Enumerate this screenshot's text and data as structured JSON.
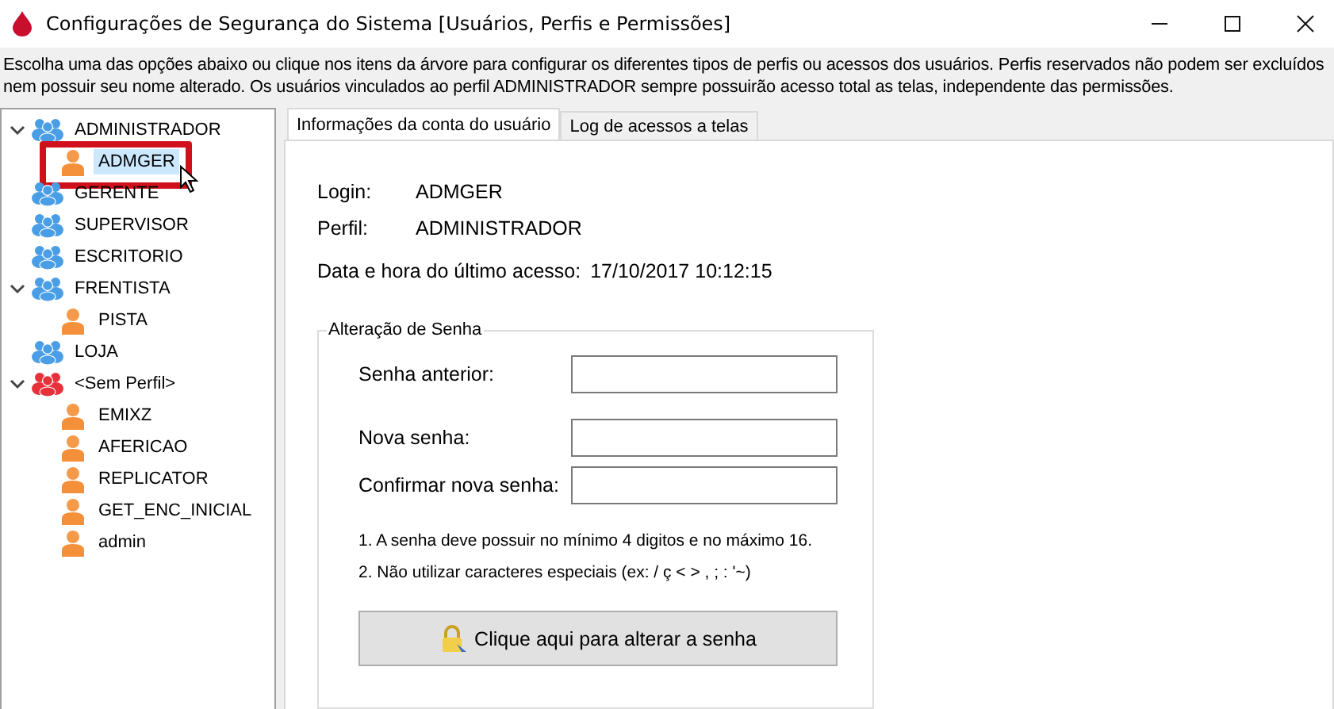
{
  "window": {
    "title": "Configurações de Segurança do Sistema [Usuários, Perfis e Permissões]"
  },
  "description": "Escolha uma das opções abaixo ou clique nos itens da árvore para configurar os diferentes tipos de perfis ou acessos dos usuários. Perfis reservados não podem ser excluídos nem possuir seu nome alterado. Os usuários vinculados ao perfil ADMINISTRADOR sempre possuirão acesso total as telas, independente das permissões.",
  "tree": [
    {
      "label": "ADMINISTRADOR",
      "kind": "group",
      "color": "#4a9ee6",
      "selected": false,
      "expanded": true,
      "children": [
        {
          "label": "ADMGER",
          "kind": "user",
          "selected": true
        }
      ]
    },
    {
      "label": "GERENTE",
      "kind": "group",
      "color": "#4a9ee6",
      "selected": false
    },
    {
      "label": "SUPERVISOR",
      "kind": "group",
      "color": "#4a9ee6",
      "selected": false
    },
    {
      "label": "ESCRITORIO",
      "kind": "group",
      "color": "#4a9ee6",
      "selected": false
    },
    {
      "label": "FRENTISTA",
      "kind": "group",
      "color": "#4a9ee6",
      "selected": false,
      "expanded": true,
      "children": [
        {
          "label": "PISTA",
          "kind": "user",
          "selected": false
        }
      ]
    },
    {
      "label": "LOJA",
      "kind": "group",
      "color": "#4a9ee6",
      "selected": false
    },
    {
      "label": "<Sem Perfil>",
      "kind": "group",
      "color": "#e8303a",
      "selected": false,
      "expanded": true,
      "children": [
        {
          "label": "EMIXZ",
          "kind": "user",
          "selected": false
        },
        {
          "label": "AFERICAO",
          "kind": "user",
          "selected": false
        },
        {
          "label": "REPLICATOR",
          "kind": "user",
          "selected": false
        },
        {
          "label": "GET_ENC_INICIAL",
          "kind": "user",
          "selected": false
        },
        {
          "label": "admin",
          "kind": "user",
          "selected": false
        }
      ]
    }
  ],
  "tabs": [
    {
      "label": "Informações da conta do usuário",
      "selected": true
    },
    {
      "label": "Log de acessos a telas",
      "selected": false
    }
  ],
  "account": {
    "login_label": "Login:",
    "login": "ADMGER",
    "profile_label": "Perfil:",
    "profile": "ADMINISTRADOR",
    "last_access_label": "Data e hora do último acesso:",
    "last_access": "17/10/2017 10:12:15"
  },
  "password_group": {
    "title": "Alteração de Senha",
    "fields": [
      {
        "label": "Senha anterior:"
      },
      {
        "label": "Nova senha:"
      },
      {
        "label": "Confirmar nova senha:"
      }
    ],
    "notes": [
      "1. A senha deve possuir no mínimo 4 digitos e no máximo 16.",
      "2. Não utilizar caracteres especiais (ex: / ç < > , ; : '~)"
    ],
    "button": "Clique aqui para alterar a senha"
  }
}
